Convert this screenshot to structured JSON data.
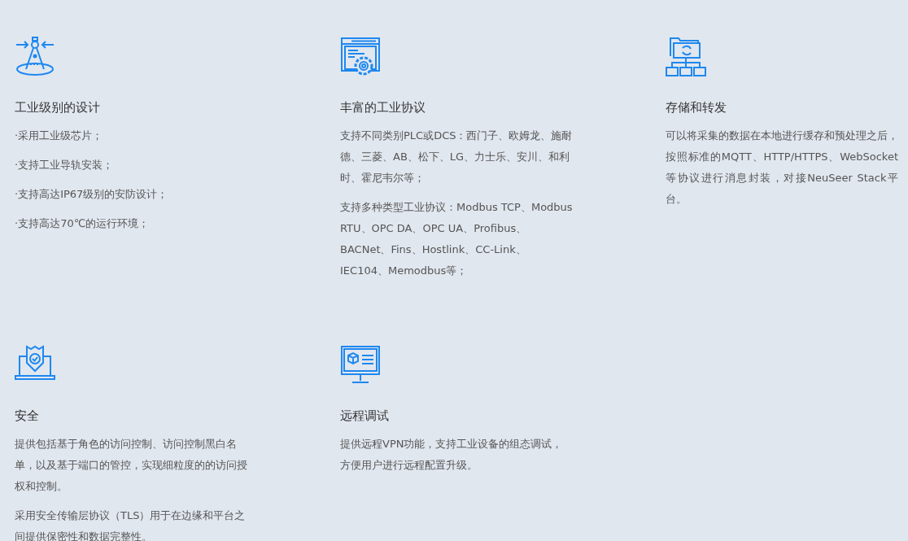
{
  "features": [
    {
      "kind": "compass",
      "title": "工业级别的设计",
      "paragraphs": [
        "·采用工业级芯片；",
        "·支持工业导轨安装；",
        "·支持高达IP67级别的安防设计；",
        "·支持高达70℃的运行环境；"
      ]
    },
    {
      "kind": "code",
      "title": "丰富的工业协议",
      "paragraphs": [
        "支持不同类别PLC或DCS：西门子、欧姆龙、施耐德、三菱、AB、松下、LG、力士乐、安川、和利时、霍尼韦尔等；",
        "支持多种类型工业协议：Modbus TCP、Modbus RTU、OPC DA、OPC UA、Profibus、BACNet、Fins、Hostlink、CC-Link、IEC104、Memodbus等；"
      ]
    },
    {
      "kind": "storage",
      "title": "存储和转发",
      "paragraphs": [
        "可以将采集的数据在本地进行缓存和预处理之后，按照标准的MQTT、HTTP/HTTPS、WebSocket等协议进行消息封装，对接NeuSeer Stack平台。"
      ]
    },
    {
      "kind": "security",
      "title": "安全",
      "paragraphs": [
        "提供包括基于角色的访问控制、访问控制黑白名单，以及基于端口的管控，实现细粒度的的访问授权和控制。",
        "采用安全传输层协议（TLS）用于在边缘和平台之间提供保密性和数据完整性。"
      ]
    },
    {
      "kind": "remote",
      "title": "远程调试",
      "paragraphs": [
        "提供远程VPN功能，支持工业设备的组态调试，方便用户进行远程配置升级。"
      ]
    }
  ]
}
